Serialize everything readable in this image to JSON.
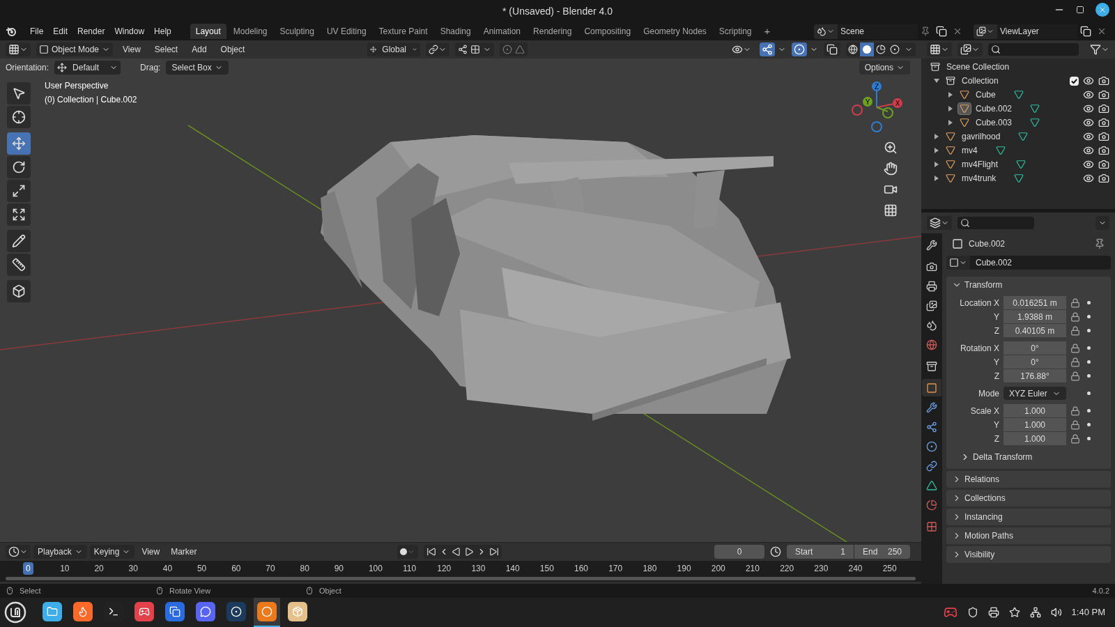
{
  "window": {
    "title": "* (Unsaved) - Blender 4.0"
  },
  "menu": [
    "File",
    "Edit",
    "Render",
    "Window",
    "Help"
  ],
  "workspaces": [
    {
      "label": "Layout",
      "selected": true
    },
    {
      "label": "Modeling",
      "selected": false
    },
    {
      "label": "Sculpting",
      "selected": false
    },
    {
      "label": "UV Editing",
      "selected": false
    },
    {
      "label": "Texture Paint",
      "selected": false
    },
    {
      "label": "Shading",
      "selected": false
    },
    {
      "label": "Animation",
      "selected": false
    },
    {
      "label": "Rendering",
      "selected": false
    },
    {
      "label": "Compositing",
      "selected": false
    },
    {
      "label": "Geometry Nodes",
      "selected": false
    },
    {
      "label": "Scripting",
      "selected": false
    }
  ],
  "add_workspace": "+",
  "scene": "Scene",
  "view_layer": "ViewLayer",
  "viewport_header": {
    "mode": "Object Mode",
    "menus": [
      "View",
      "Select",
      "Add",
      "Object"
    ],
    "transform_orientation": "Global",
    "shading": [
      {
        "selected": false
      },
      {
        "selected": true
      },
      {
        "selected": false
      },
      {
        "selected": false
      }
    ],
    "gizmos_on": true,
    "overlays_on": true
  },
  "tool_settings": {
    "orientation_label": "Orientation:",
    "orientation": "Default",
    "drag_label": "Drag:",
    "drag": "Select Box",
    "options": "Options"
  },
  "viewport": {
    "view_name": "User Perspective",
    "context": "(0) Collection | Cube.002",
    "axes": [
      "Z",
      "Y",
      "X"
    ],
    "tools": [
      {
        "selected": false
      },
      {
        "selected": false
      },
      {
        "selected": true
      },
      {
        "selected": false
      },
      {
        "selected": false
      },
      {
        "selected": false
      },
      {
        "selected": false
      },
      {
        "selected": false
      },
      {
        "selected": false
      }
    ]
  },
  "outliner": {
    "items": [
      {
        "name": "Scene Collection",
        "kind": "scene",
        "children": [
          {
            "name": "Collection",
            "kind": "collection",
            "expanded": true,
            "checked": true,
            "selected": false,
            "children": [
              {
                "name": "Cube",
                "kind": "mesh",
                "expanded": false,
                "selected": false
              },
              {
                "name": "Cube.002",
                "kind": "mesh",
                "expanded": false,
                "selected": true
              },
              {
                "name": "Cube.003",
                "kind": "mesh",
                "expanded": false,
                "selected": false
              }
            ]
          },
          {
            "name": "gavrilhood",
            "kind": "mesh",
            "expanded": false,
            "selected": false
          },
          {
            "name": "mv4",
            "kind": "mesh",
            "expanded": false,
            "selected": false
          },
          {
            "name": "mv4Flight",
            "kind": "mesh",
            "expanded": false,
            "selected": false
          },
          {
            "name": "mv4trunk",
            "kind": "mesh",
            "expanded": false,
            "selected": false
          }
        ]
      }
    ]
  },
  "properties": {
    "tabs": [
      {
        "selected": false
      },
      {
        "selected": false
      },
      {
        "selected": false
      },
      {
        "selected": false
      },
      {
        "selected": false
      },
      {
        "selected": false
      },
      {
        "selected": false
      },
      {
        "selected": true
      },
      {
        "selected": false
      },
      {
        "selected": false
      },
      {
        "selected": false
      },
      {
        "selected": false
      },
      {
        "selected": false
      },
      {
        "selected": false
      },
      {
        "selected": false
      }
    ],
    "object_name": "Cube.002",
    "datablock": "Cube.002",
    "transform": {
      "title": "Transform",
      "expanded": true,
      "groups": [
        [
          {
            "label": "Location X",
            "value": "0.016251 m",
            "kind": "number"
          },
          {
            "label": "Y",
            "value": "1.9388 m",
            "kind": "number"
          },
          {
            "label": "Z",
            "value": "0.40105 m",
            "kind": "number"
          }
        ],
        [
          {
            "label": "Rotation X",
            "value": "0°",
            "kind": "number"
          },
          {
            "label": "Y",
            "value": "0°",
            "kind": "number"
          },
          {
            "label": "Z",
            "value": "176.88°",
            "kind": "number"
          }
        ],
        [
          {
            "label": "Mode",
            "value": "XYZ Euler",
            "kind": "dropdown"
          }
        ],
        [
          {
            "label": "Scale X",
            "value": "1.000",
            "kind": "number"
          },
          {
            "label": "Y",
            "value": "1.000",
            "kind": "number"
          },
          {
            "label": "Z",
            "value": "1.000",
            "kind": "number"
          }
        ]
      ],
      "subpanel": {
        "title": "Delta Transform",
        "expanded": false
      }
    },
    "panels": [
      {
        "title": "Relations",
        "expanded": false
      },
      {
        "title": "Collections",
        "expanded": false
      },
      {
        "title": "Instancing",
        "expanded": false
      },
      {
        "title": "Motion Paths",
        "expanded": false
      },
      {
        "title": "Visibility",
        "expanded": false
      }
    ]
  },
  "timeline": {
    "menus": [
      "Playback",
      "Keying",
      "View",
      "Marker"
    ],
    "current_frame": "0",
    "start_label": "Start",
    "start": "1",
    "end_label": "End",
    "end": "250",
    "ticks": [
      {
        "label": "0",
        "selected": true
      },
      {
        "label": "10",
        "selected": false
      },
      {
        "label": "20",
        "selected": false
      },
      {
        "label": "30",
        "selected": false
      },
      {
        "label": "40",
        "selected": false
      },
      {
        "label": "50",
        "selected": false
      },
      {
        "label": "60",
        "selected": false
      },
      {
        "label": "70",
        "selected": false
      },
      {
        "label": "80",
        "selected": false
      },
      {
        "label": "90",
        "selected": false
      },
      {
        "label": "100",
        "selected": false
      },
      {
        "label": "110",
        "selected": false
      },
      {
        "label": "120",
        "selected": false
      },
      {
        "label": "130",
        "selected": false
      },
      {
        "label": "140",
        "selected": false
      },
      {
        "label": "150",
        "selected": false
      },
      {
        "label": "160",
        "selected": false
      },
      {
        "label": "170",
        "selected": false
      },
      {
        "label": "180",
        "selected": false
      },
      {
        "label": "190",
        "selected": false
      },
      {
        "label": "200",
        "selected": false
      },
      {
        "label": "210",
        "selected": false
      },
      {
        "label": "220",
        "selected": false
      },
      {
        "label": "230",
        "selected": false
      },
      {
        "label": "240",
        "selected": false
      },
      {
        "label": "250",
        "selected": false
      }
    ]
  },
  "status_bar": {
    "hints": [
      "Select",
      "Rotate View",
      "Object"
    ],
    "version": "4.0.2"
  },
  "taskbar": {
    "apps": [
      {
        "active": false
      },
      {
        "active": false
      },
      {
        "active": false
      },
      {
        "active": false
      },
      {
        "active": false
      },
      {
        "active": false
      },
      {
        "active": false
      },
      {
        "active": true
      },
      {
        "active": false
      }
    ],
    "clock": "1:40 PM"
  }
}
